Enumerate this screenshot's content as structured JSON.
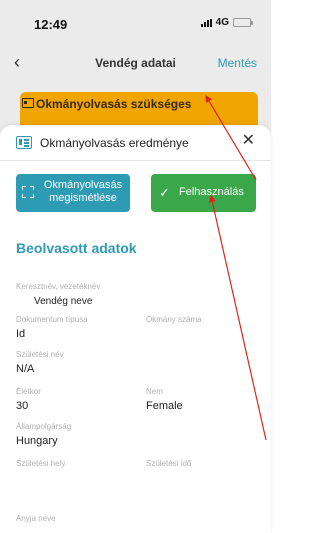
{
  "status_bar": {
    "time": "12:49",
    "network": "4G",
    "battery_color": "#f5d200"
  },
  "nav": {
    "back_icon": "chevron-left-icon",
    "title": "Vendég adatai",
    "save_label": "Mentés"
  },
  "warning": {
    "icon": "id-card-icon",
    "title": "Okmányolvasás szükséges",
    "color": "#f0a500"
  },
  "sheet": {
    "icon": "id-card-icon",
    "title": "Okmányolvasás eredménye",
    "close_icon": "close-icon",
    "rescan_label": "Okmányolvasás megismétlése",
    "use_label": "Felhasználás",
    "section_title": "Beolvasott adatok",
    "fields": {
      "name_label": "Keresztnév, vezetéknév",
      "name_value": "Vendég neve",
      "doc_type_label": "Dokumentum típusa",
      "doc_type_value": "Id",
      "doc_number_label": "Okmány száma",
      "doc_number_value": "",
      "birth_name_label": "Születési név",
      "birth_name_value": "N/A",
      "age_label": "Életkor",
      "age_value": "30",
      "gender_label": "Nem",
      "gender_value": "Female",
      "citizenship_label": "Állampolgárság",
      "citizenship_value": "Hungary",
      "birth_place_label": "Születési hely",
      "birth_place_value": "",
      "birth_time_label": "Születési idő",
      "birth_time_value": "",
      "mother_name_label": "Anyja neve",
      "mother_name_value": ""
    }
  },
  "colors": {
    "accent": "#2e9bb5",
    "success": "#3aa84a",
    "annotation": "#e2231a"
  }
}
